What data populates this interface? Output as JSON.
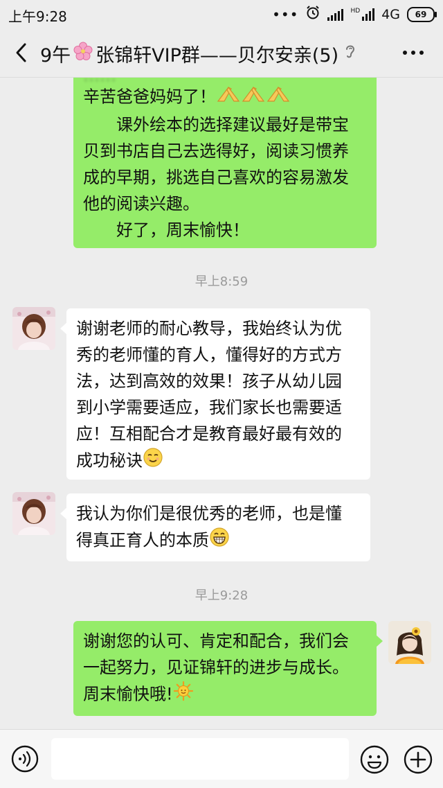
{
  "status_bar": {
    "time": "上午9:28",
    "network": "4G",
    "battery": "69",
    "hd_label": "HD"
  },
  "nav": {
    "title_prefix": "9午",
    "title_main": "张锦轩VIP群——贝尔安亲(5)",
    "flower_icon": "cherry-blossom-icon",
    "mute_icon": "ear-icon"
  },
  "messages": [
    {
      "id": "m1",
      "side": "right",
      "color": "#95ec69",
      "lines": [
        "辛苦爸爸妈妈了！",
        "　　课外绘本的选择建议最好是带宝",
        "贝到书店自己去选得好，阅读习惯养",
        "成的早期，挑选自己喜欢的容易激发",
        "他的阅读兴趣。",
        "　　好了，周末愉快！"
      ],
      "emoji_after_line0": "🙏🙏🙏"
    },
    {
      "id": "t1",
      "type": "timestamp",
      "text": "早上8:59"
    },
    {
      "id": "m2",
      "side": "left",
      "lines": [
        "谢谢老师的耐心教导，我始终认为优",
        "秀的老师懂的育人，懂得好的方式方",
        "法，达到高效的效果！孩子从幼儿园",
        "到小学需要适应，我们家长也需要适",
        "应！互相配合才是教育最好最有效的",
        "成功秘诀"
      ],
      "emoji": "😌"
    },
    {
      "id": "m3",
      "side": "left",
      "lines": [
        "我认为你们是很优秀的老师，也是懂",
        "得真正育人的本质"
      ],
      "emoji": "😁"
    },
    {
      "id": "t2",
      "type": "timestamp",
      "text": "早上9:28"
    },
    {
      "id": "m4",
      "side": "right",
      "lines": [
        "谢谢您的认可、肯定和配合，我们会",
        "一起努力，见证锦轩的进步与成长。",
        "周末愉快哦!"
      ],
      "emoji": "🌞"
    }
  ],
  "input_bar": {
    "placeholder": "",
    "voice_icon": "voice-icon",
    "emoji_icon": "emoji-icon",
    "plus_icon": "plus-icon"
  }
}
